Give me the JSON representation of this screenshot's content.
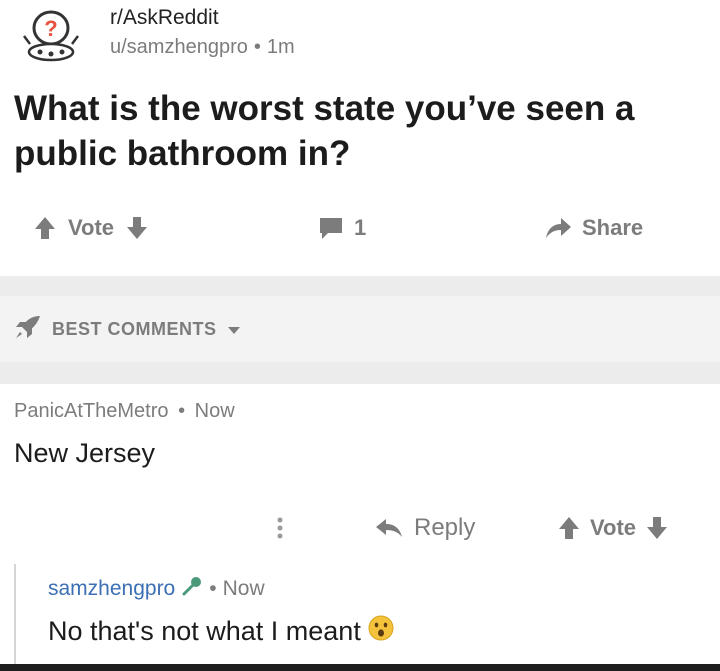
{
  "post": {
    "subreddit": "r/AskReddit",
    "author": "u/samzhengpro",
    "separator": "•",
    "age": "1m",
    "title": "What is the worst state you’ve seen a public bathroom in?",
    "vote_label": "Vote",
    "comment_count": "1",
    "share_label": "Share"
  },
  "sort": {
    "label": "BEST COMMENTS"
  },
  "comments": [
    {
      "author": "PanicAtTheMetro",
      "separator": "•",
      "age": "Now",
      "body": "New Jersey",
      "reply_label": "Reply",
      "vote_label": "Vote"
    }
  ],
  "reply": {
    "author": "samzhengpro",
    "separator": "•",
    "age": "Now",
    "body": "No that's not what I meant"
  },
  "icons": {
    "avatar": "askreddit-snoo-icon",
    "upvote": "arrow-up-icon",
    "downvote": "arrow-down-icon",
    "comment": "comment-bubble-icon",
    "share": "share-arrow-icon",
    "sort": "rocket-icon",
    "dropdown": "chevron-down-icon",
    "more": "more-vertical-icon",
    "reply": "reply-arrow-icon",
    "flair": "microphone-icon",
    "emoji": "surprised-face-icon"
  },
  "colors": {
    "username_link": "#3d6fb5",
    "muted_text": "#7c7c7c",
    "section_band": "#ececec"
  }
}
